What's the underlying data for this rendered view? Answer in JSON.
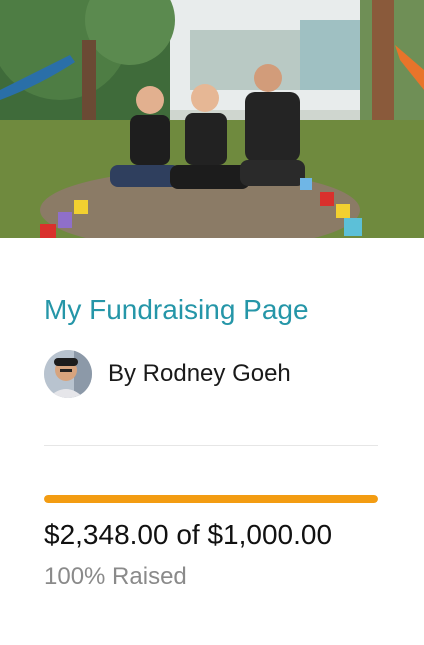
{
  "campaign": {
    "title": "My Fundraising Page",
    "owner_line": "By Rodney Goeh",
    "amount_text": "$2,348.00 of $1,000.00",
    "raised_text": "100% Raised",
    "progress_fraction": 1.0
  },
  "colors": {
    "title": "#2596a8",
    "progress_fill": "#f39c12",
    "progress_track": "#eeeeee",
    "muted_text": "#8a8a8a"
  },
  "images": {
    "hero": "hero-photo",
    "avatar": "avatar-photo"
  }
}
